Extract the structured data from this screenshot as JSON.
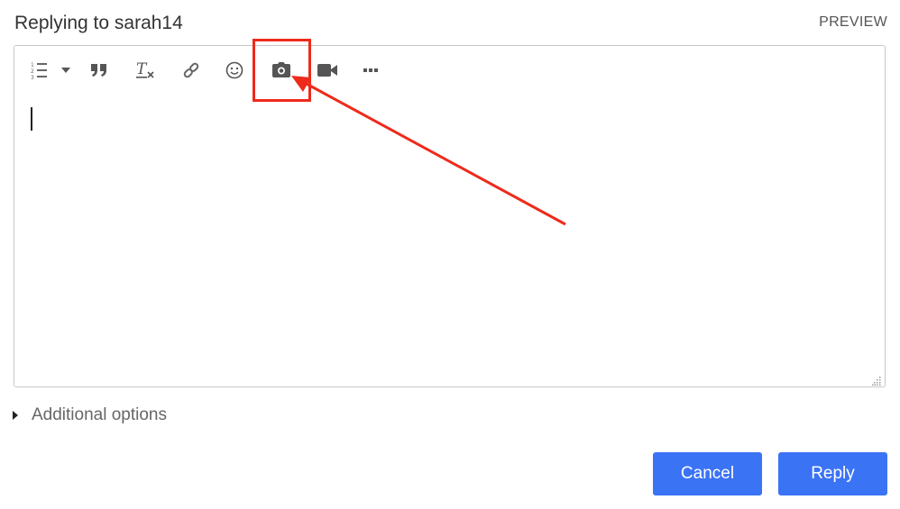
{
  "header": {
    "title": "Replying to sarah14",
    "preview_label": "PREVIEW"
  },
  "editor": {
    "toolbar": [
      {
        "name": "numbered-list-icon",
        "tooltip": ""
      },
      {
        "name": "list-dropdown-icon",
        "tooltip": ""
      },
      {
        "name": "quote-icon",
        "tooltip": ""
      },
      {
        "name": "clear-formatting-icon",
        "tooltip": ""
      },
      {
        "name": "link-icon",
        "tooltip": ""
      },
      {
        "name": "emoji-icon",
        "tooltip": ""
      },
      {
        "name": "camera-icon",
        "tooltip": ""
      },
      {
        "name": "video-icon",
        "tooltip": ""
      },
      {
        "name": "more-icon",
        "tooltip": ""
      }
    ],
    "body_value": ""
  },
  "additional_options": {
    "label": "Additional options"
  },
  "actions": {
    "cancel_label": "Cancel",
    "reply_label": "Reply"
  },
  "annotation": {
    "color": "#ee2a1b",
    "target": "camera-icon"
  },
  "colors": {
    "primary_button": "#3b73f5",
    "toolbar_icon": "#666666",
    "border": "#c8c8c8"
  }
}
